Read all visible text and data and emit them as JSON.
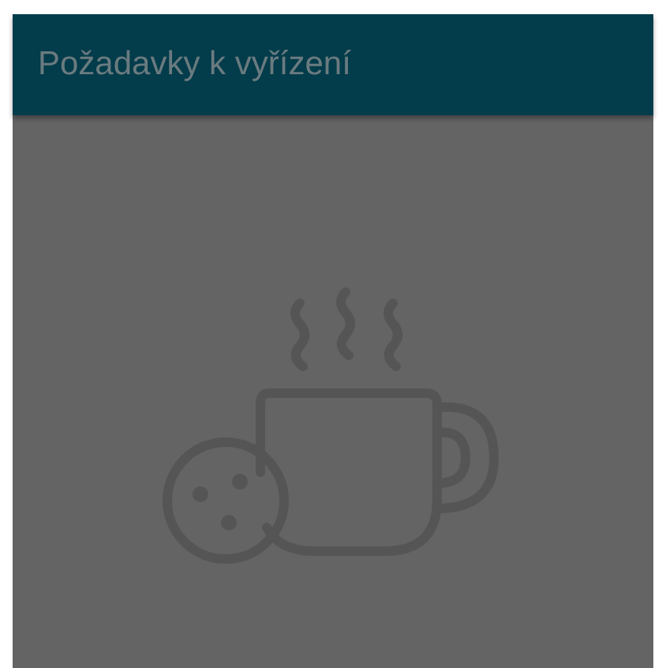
{
  "header": {
    "title": "Požadavky k vyřízení"
  }
}
